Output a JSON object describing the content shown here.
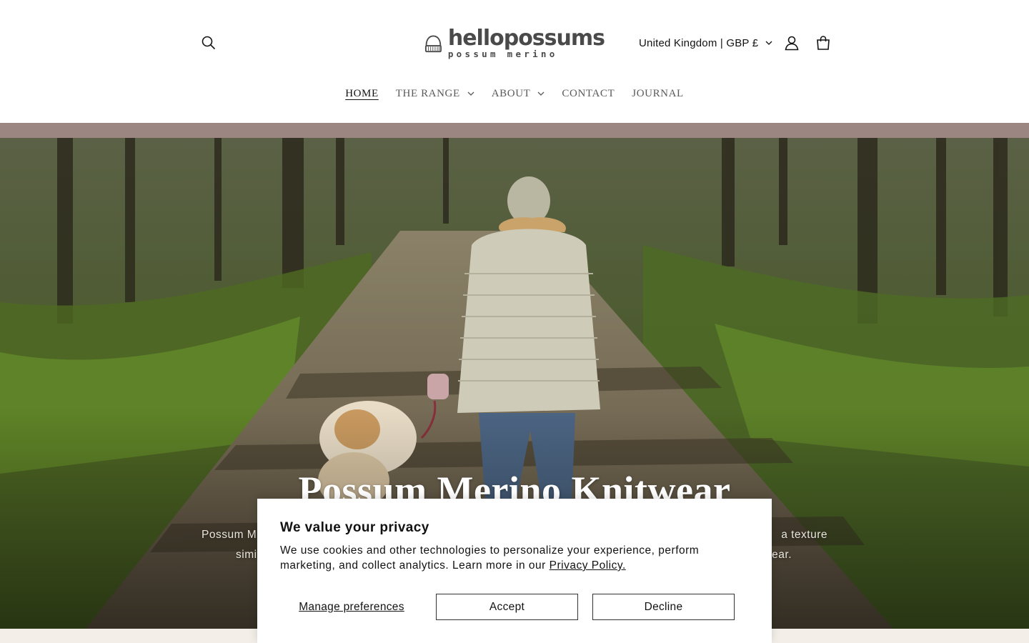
{
  "header": {
    "logo": {
      "name": "hellopossums",
      "tagline": "possum merino"
    },
    "country_selector": "United Kingdom | GBP £",
    "icons": {
      "search": "search-icon",
      "account": "account-icon",
      "cart": "cart-icon"
    }
  },
  "nav": {
    "items": [
      {
        "label": "HOME",
        "active": true,
        "has_dropdown": false
      },
      {
        "label": "THE RANGE",
        "active": false,
        "has_dropdown": true
      },
      {
        "label": "ABOUT",
        "active": false,
        "has_dropdown": true
      },
      {
        "label": "CONTACT",
        "active": false,
        "has_dropdown": false
      },
      {
        "label": "JOURNAL",
        "active": false,
        "has_dropdown": false
      }
    ]
  },
  "hero": {
    "title": "Possum Merino Knitwear",
    "text_line1": "Possum M",
    "text_line1_end": "a texture",
    "text_line2": "simi",
    "text_line2_end": "ear."
  },
  "cookie_banner": {
    "title": "We value your privacy",
    "body": "We use cookies and other technologies to personalize your experience, perform marketing, and collect analytics. Learn more in our ",
    "link": "Privacy Policy.",
    "manage_label": "Manage preferences",
    "accept_label": "Accept",
    "decline_label": "Decline"
  },
  "colors": {
    "announce_bar": "#9c8682",
    "text": "#121212",
    "nav_text": "#5a5a5a",
    "strip": "#f3efe8"
  }
}
